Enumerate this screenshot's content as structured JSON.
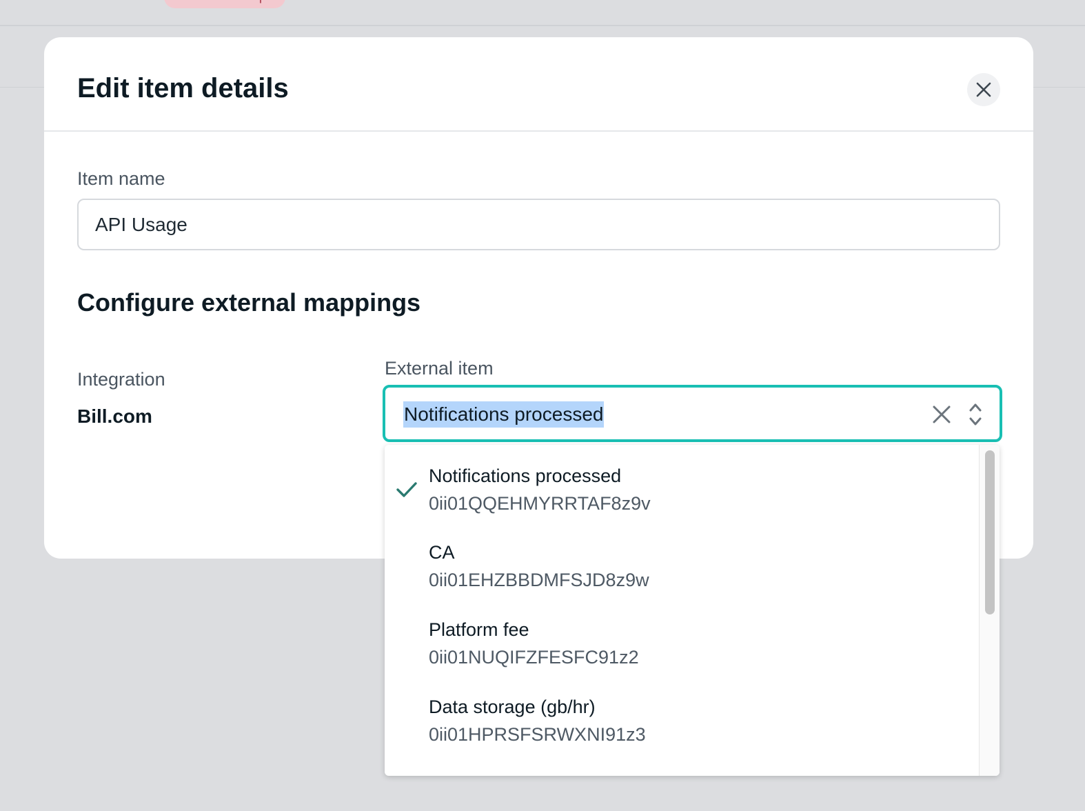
{
  "background": {
    "badge_label": "Needs setup"
  },
  "modal": {
    "title": "Edit item details",
    "close_icon": "close-icon",
    "item_name": {
      "label": "Item name",
      "value": "API Usage"
    },
    "mappings": {
      "title": "Configure external mappings",
      "integration_label": "Integration",
      "integration_value": "Bill.com",
      "external_item_label": "External item",
      "selected_value": "Notifications processed",
      "options": [
        {
          "label": "Notifications processed",
          "id": "0ii01QQEHMYRRTAF8z9v",
          "selected": true
        },
        {
          "label": "CA",
          "id": "0ii01EHZBBDMFSJD8z9w",
          "selected": false
        },
        {
          "label": "Platform fee",
          "id": "0ii01NUQIFZFESFC91z2",
          "selected": false
        },
        {
          "label": "Data storage (gb/hr)",
          "id": "0ii01HPRSFSRWXNI91z3",
          "selected": false
        }
      ]
    }
  },
  "colors": {
    "focus_ring": "#19bfb3",
    "check": "#2a7a70",
    "selection_highlight": "#b4d5fb"
  }
}
